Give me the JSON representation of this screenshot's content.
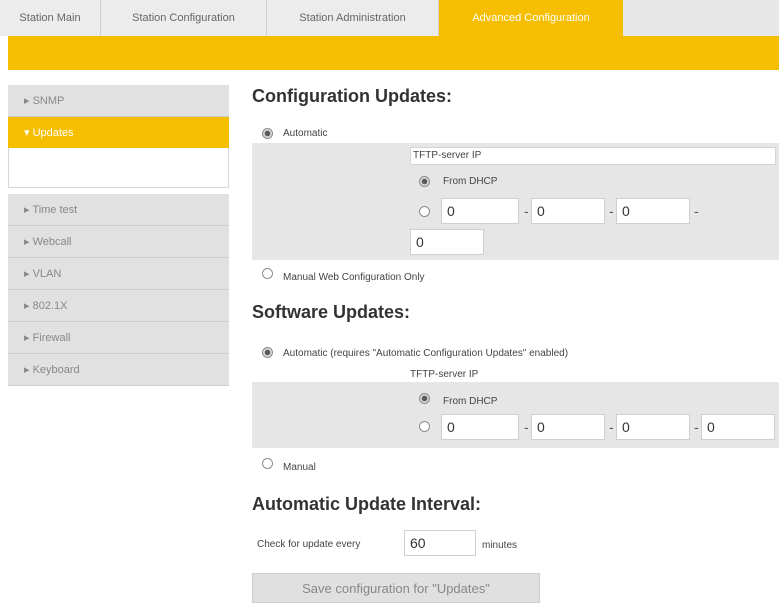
{
  "tabs": [
    {
      "label": "Station Main"
    },
    {
      "label": "Station Configuration"
    },
    {
      "label": "Station Administration"
    },
    {
      "label": "Advanced Configuration"
    }
  ],
  "sidebar": {
    "items": [
      {
        "label": "▸ SNMP"
      },
      {
        "label": "▾ Updates"
      },
      {
        "label": "▸ Time test"
      },
      {
        "label": "▸ Webcall"
      },
      {
        "label": "▸ VLAN"
      },
      {
        "label": "▸ 802.1X"
      },
      {
        "label": "▸ Firewall"
      },
      {
        "label": "▸ Keyboard"
      }
    ]
  },
  "config_updates": {
    "heading": "Configuration Updates:",
    "automatic_label": "Automatic",
    "tftp_label": "TFTP-server IP",
    "from_dhcp_label": "From DHCP",
    "ip": [
      "0",
      "0",
      "0",
      "0"
    ],
    "manual_label": "Manual Web Configuration Only"
  },
  "software_updates": {
    "heading": "Software Updates:",
    "automatic_label": "Automatic (requires \"Automatic Configuration Updates\" enabled)",
    "tftp_label": "TFTP-server IP",
    "from_dhcp_label": "From DHCP",
    "ip": [
      "0",
      "0",
      "0",
      "0"
    ],
    "manual_label": "Manual"
  },
  "interval": {
    "heading": "Automatic Update Interval:",
    "check_label": "Check for update every",
    "value": "60",
    "unit": "minutes"
  },
  "save_button": {
    "label": "Save configuration for \"Updates\""
  },
  "separators": {
    "dash": "-"
  }
}
